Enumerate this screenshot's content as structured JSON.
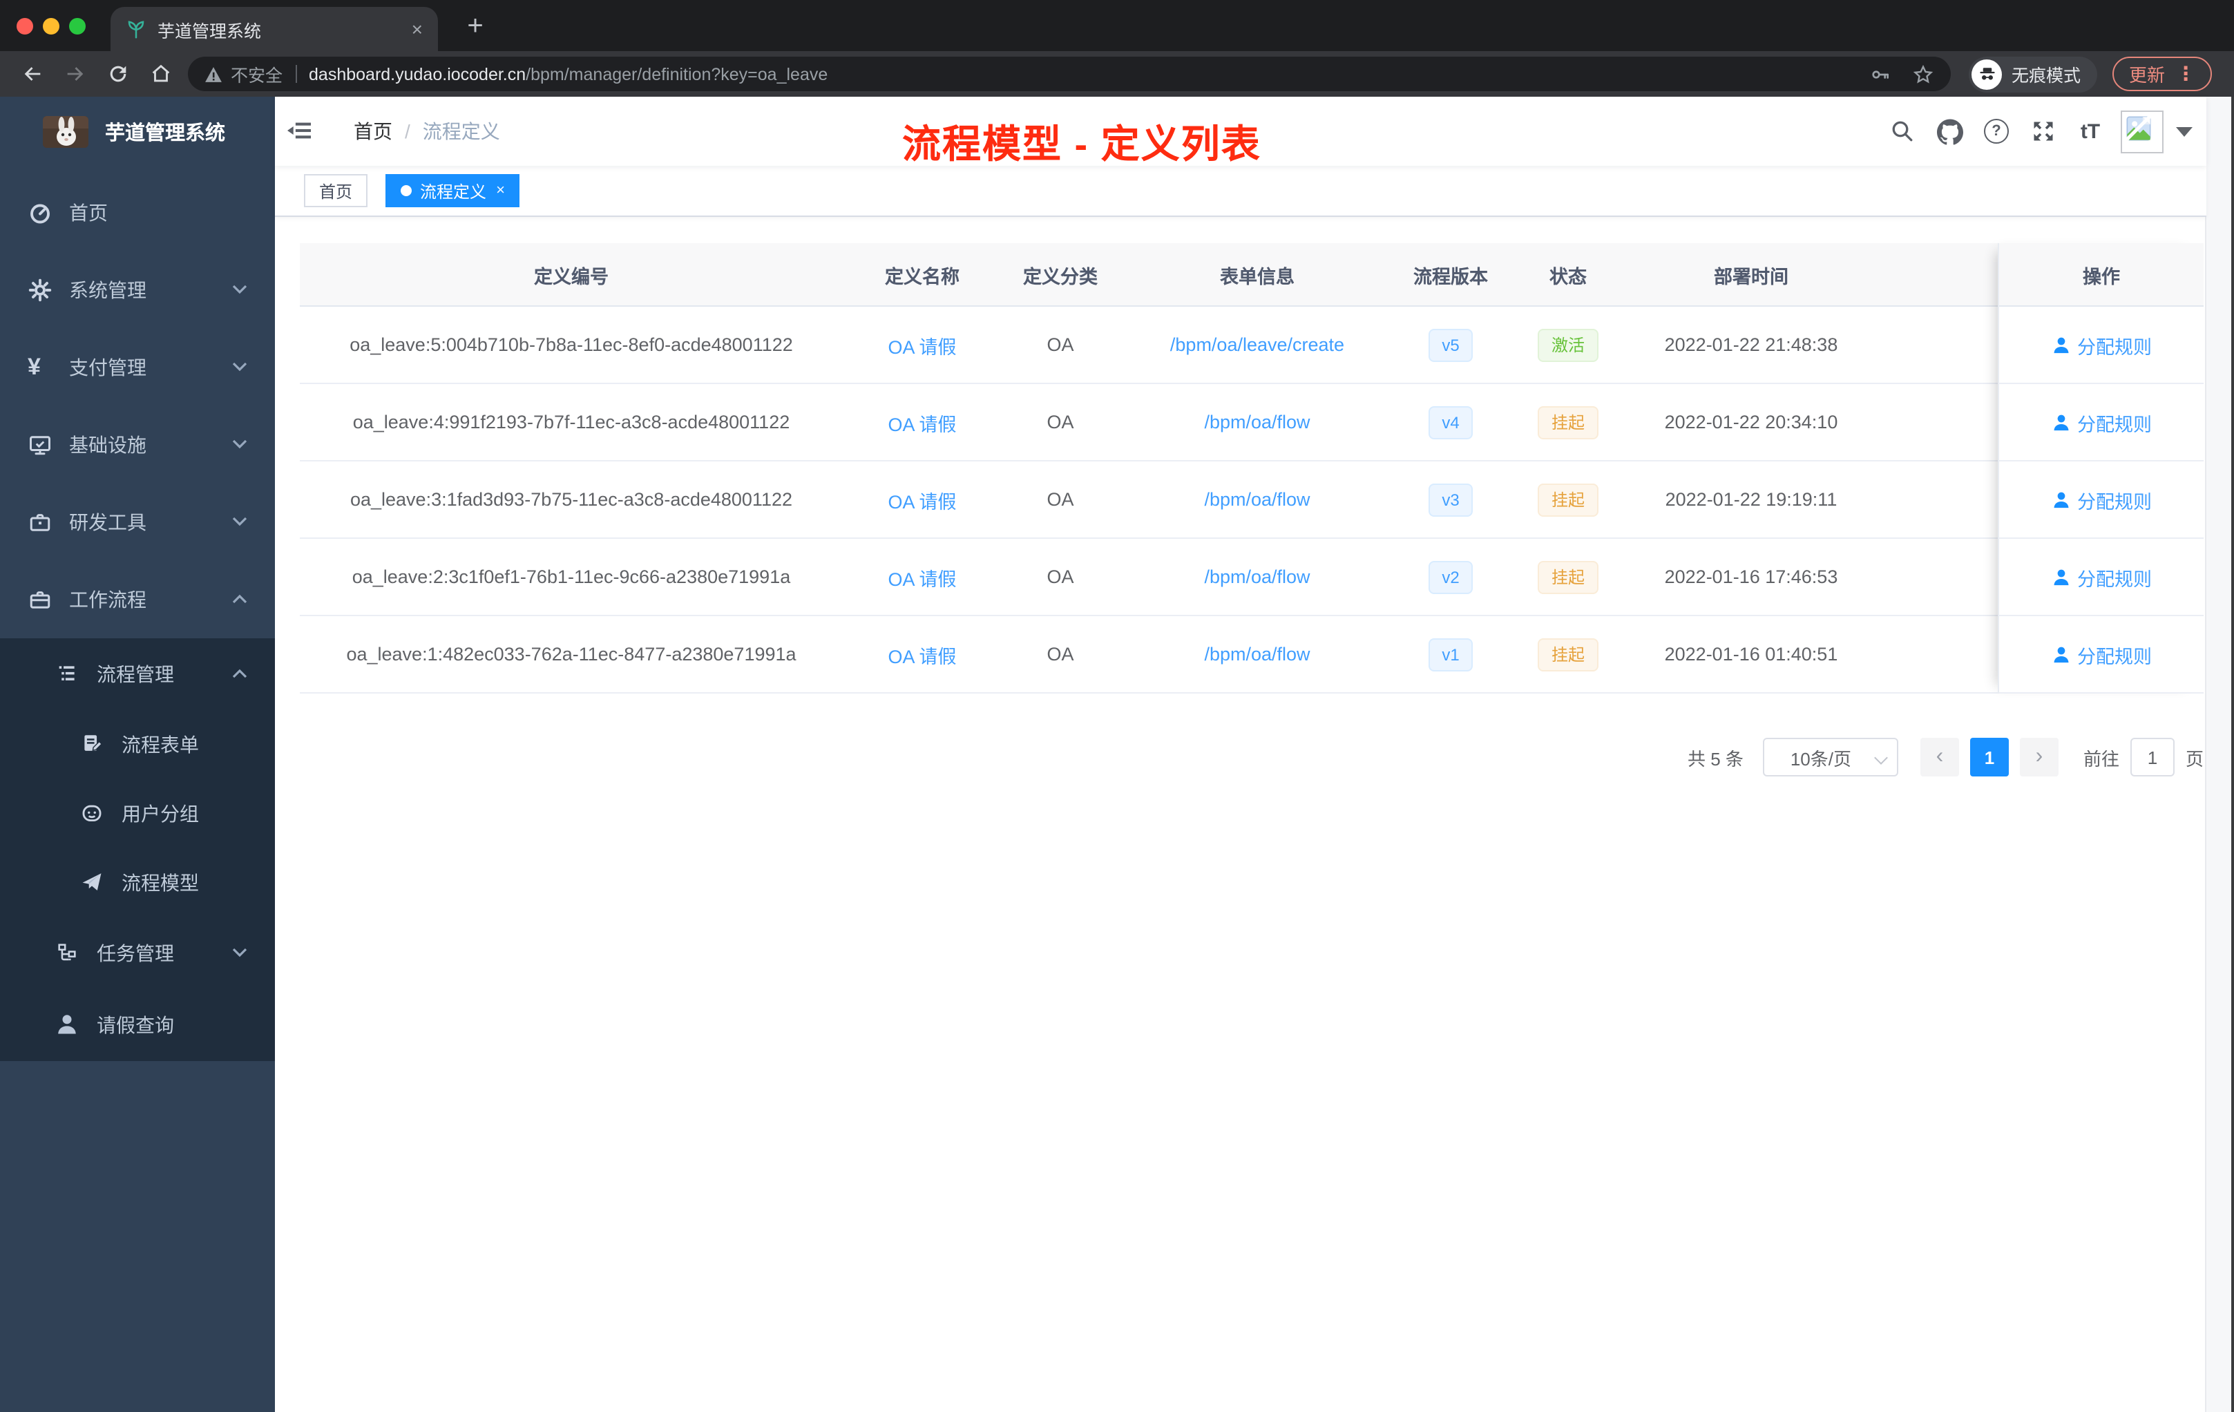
{
  "colors": {
    "primary_link": "#409eff",
    "active_tab_blue": "#1890ff",
    "success_green": "#67c23a",
    "warning_yellow": "#e6a23c",
    "annotation_red": "#fe2c10",
    "sidebar_bg": "#304156",
    "submenu_bg": "#1f2d3d"
  },
  "browser": {
    "tab_title": "芋道管理系统",
    "tab_close_glyph": "×",
    "new_tab_glyph": "+",
    "security_label": "不安全",
    "url_domain": "dashboard.yudao.iocoder.cn",
    "url_path": "/bpm/manager/definition?key=oa_leave",
    "incognito_label": "无痕模式",
    "update_label": "更新",
    "menu_glyph": "⋮"
  },
  "sidebar": {
    "logo_title": "芋道管理系统",
    "yen_glyph": "¥",
    "items": [
      {
        "label": "首页"
      },
      {
        "label": "系统管理"
      },
      {
        "label": "支付管理"
      },
      {
        "label": "基础设施"
      },
      {
        "label": "研发工具"
      },
      {
        "label": "工作流程"
      },
      {
        "label": "流程管理"
      },
      {
        "label": "流程表单"
      },
      {
        "label": "用户分组"
      },
      {
        "label": "流程模型"
      },
      {
        "label": "任务管理"
      },
      {
        "label": "请假查询"
      }
    ]
  },
  "navbar": {
    "breadcrumb": [
      "首页",
      "流程定义"
    ],
    "breadcrumb_separator": "/",
    "font_size_glyph": "tT",
    "help_glyph": "?"
  },
  "annotation": {
    "text": "流程模型 - 定义列表"
  },
  "tags": {
    "close_glyph": "×",
    "items": [
      {
        "label": "首页",
        "active": false
      },
      {
        "label": "流程定义",
        "active": true
      }
    ]
  },
  "table": {
    "columns": [
      "定义编号",
      "定义名称",
      "定义分类",
      "表单信息",
      "流程版本",
      "状态",
      "部署时间",
      "操作"
    ],
    "action_label": "分配规则",
    "rows": [
      {
        "id": "oa_leave:5:004b710b-7b8a-11ec-8ef0-acde48001122",
        "name": "OA 请假",
        "category": "OA",
        "form": "/bpm/oa/leave/create",
        "version": "v5",
        "status": "激活",
        "status_type": "success",
        "deploy_time": "2022-01-22 21:48:38"
      },
      {
        "id": "oa_leave:4:991f2193-7b7f-11ec-a3c8-acde48001122",
        "name": "OA 请假",
        "category": "OA",
        "form": "/bpm/oa/flow",
        "version": "v4",
        "status": "挂起",
        "status_type": "warning",
        "deploy_time": "2022-01-22 20:34:10"
      },
      {
        "id": "oa_leave:3:1fad3d93-7b75-11ec-a3c8-acde48001122",
        "name": "OA 请假",
        "category": "OA",
        "form": "/bpm/oa/flow",
        "version": "v3",
        "status": "挂起",
        "status_type": "warning",
        "deploy_time": "2022-01-22 19:19:11"
      },
      {
        "id": "oa_leave:2:3c1f0ef1-76b1-11ec-9c66-a2380e71991a",
        "name": "OA 请假",
        "category": "OA",
        "form": "/bpm/oa/flow",
        "version": "v2",
        "status": "挂起",
        "status_type": "warning",
        "deploy_time": "2022-01-16 17:46:53"
      },
      {
        "id": "oa_leave:1:482ec033-762a-11ec-8477-a2380e71991a",
        "name": "OA 请假",
        "category": "OA",
        "form": "/bpm/oa/flow",
        "version": "v1",
        "status": "挂起",
        "status_type": "warning",
        "deploy_time": "2022-01-16 01:40:51"
      }
    ]
  },
  "pagination": {
    "total": "共 5 条",
    "page_size": "10条/页",
    "prev_glyph": "‹",
    "next_glyph": "›",
    "page": "1",
    "goto_label": "前往",
    "goto_value": "1",
    "unit_label": "页"
  }
}
